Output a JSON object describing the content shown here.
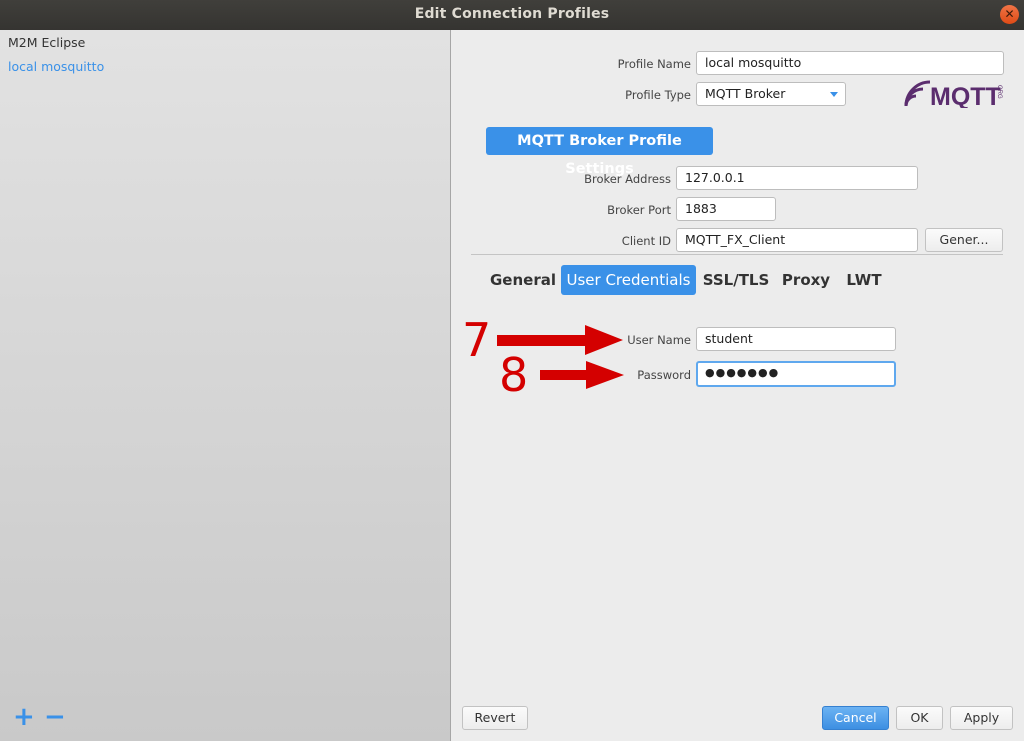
{
  "window": {
    "title": "Edit Connection Profiles"
  },
  "sidebar": {
    "items": [
      {
        "label": "M2M Eclipse"
      },
      {
        "label": "local mosquitto"
      }
    ],
    "add_icon_glyph": "+",
    "remove_icon_glyph": "−"
  },
  "profile": {
    "name_label": "Profile Name",
    "name_value": "local mosquitto",
    "type_label": "Profile Type",
    "type_value": "MQTT Broker"
  },
  "logo": {
    "text": "MQTT",
    "suffix": "ORG"
  },
  "broker": {
    "section_title": "MQTT Broker Profile Settings",
    "address_label": "Broker Address",
    "address_value": "127.0.0.1",
    "port_label": "Broker Port",
    "port_value": "1883",
    "client_id_label": "Client ID",
    "client_id_value": "MQTT_FX_Client",
    "generate_label": "Gener..."
  },
  "tabs": [
    {
      "label": "General"
    },
    {
      "label": "User Credentials"
    },
    {
      "label": "SSL/TLS"
    },
    {
      "label": "Proxy"
    },
    {
      "label": "LWT"
    }
  ],
  "credentials": {
    "username_label": "User Name",
    "username_value": "student",
    "password_label": "Password",
    "password_value": "●●●●●●●"
  },
  "annotations": {
    "step7": "7",
    "step8": "8"
  },
  "footer": {
    "revert_label": "Revert",
    "cancel_label": "Cancel",
    "ok_label": "OK",
    "apply_label": "Apply"
  },
  "colors": {
    "accent": "#3a91e8",
    "annotation": "#d40000",
    "logo": "#5b2d6e"
  }
}
